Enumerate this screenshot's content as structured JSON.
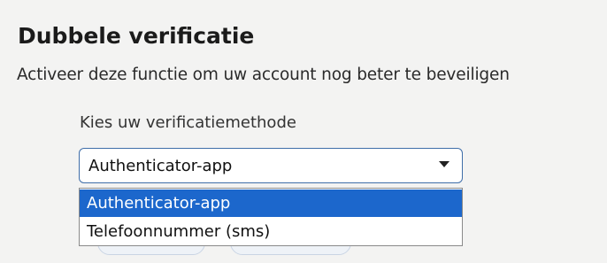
{
  "section": {
    "title": "Dubbele verificatie",
    "description": "Activeer deze functie om uw account nog beter te beveiligen"
  },
  "method_select": {
    "label": "Kies uw verificatiemethode",
    "selected_value": "Authenticator-app",
    "options": [
      {
        "label": "Authenticator-app",
        "highlighted": true
      },
      {
        "label": "Telefoonnummer (sms)",
        "highlighted": false
      }
    ]
  },
  "colors": {
    "highlight": "#1c67cc",
    "select_border": "#3f6ea9",
    "panel_background": "#f3f3f2"
  },
  "icons": {
    "select_caret": "chevron-down-icon"
  }
}
